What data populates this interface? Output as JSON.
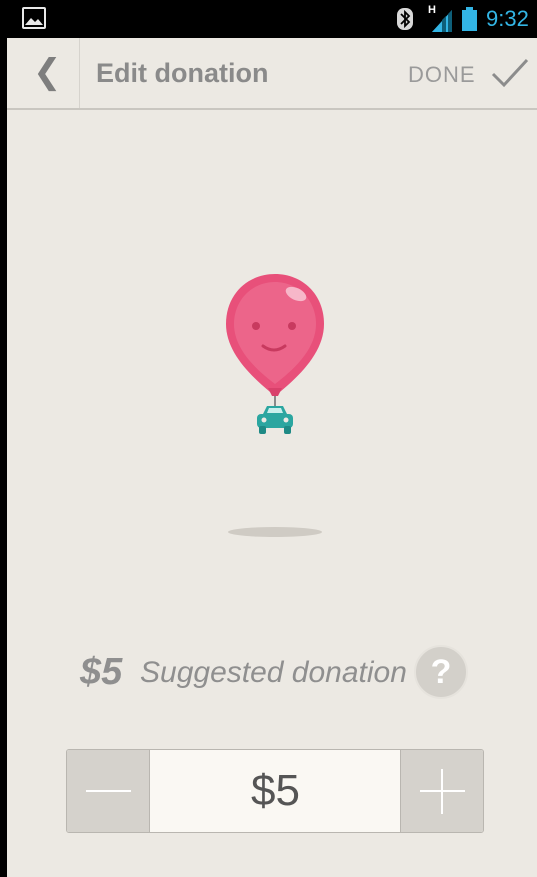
{
  "status_bar": {
    "time": "9:32",
    "network_label": "H",
    "icons": [
      "gallery-notification-icon",
      "bluetooth-icon",
      "signal-icon",
      "battery-icon"
    ],
    "time_color": "#33B5E5"
  },
  "action_bar": {
    "back_icon": "chevron-left-icon",
    "title": "Edit donation",
    "done_label": "DONE",
    "done_icon": "checkmark-icon"
  },
  "illustration": {
    "balloon_color": "#E8507A",
    "car_color": "#2BA6A0",
    "icons": [
      "smiling-balloon-icon",
      "car-icon"
    ]
  },
  "suggested": {
    "amount": "$5",
    "label": "Suggested donation",
    "help_label": "?"
  },
  "stepper": {
    "value": "$5",
    "decrement_icon": "minus-icon",
    "increment_icon": "plus-icon"
  },
  "colors": {
    "background": "#ECE9E3",
    "text_muted": "#8F8F8F"
  }
}
